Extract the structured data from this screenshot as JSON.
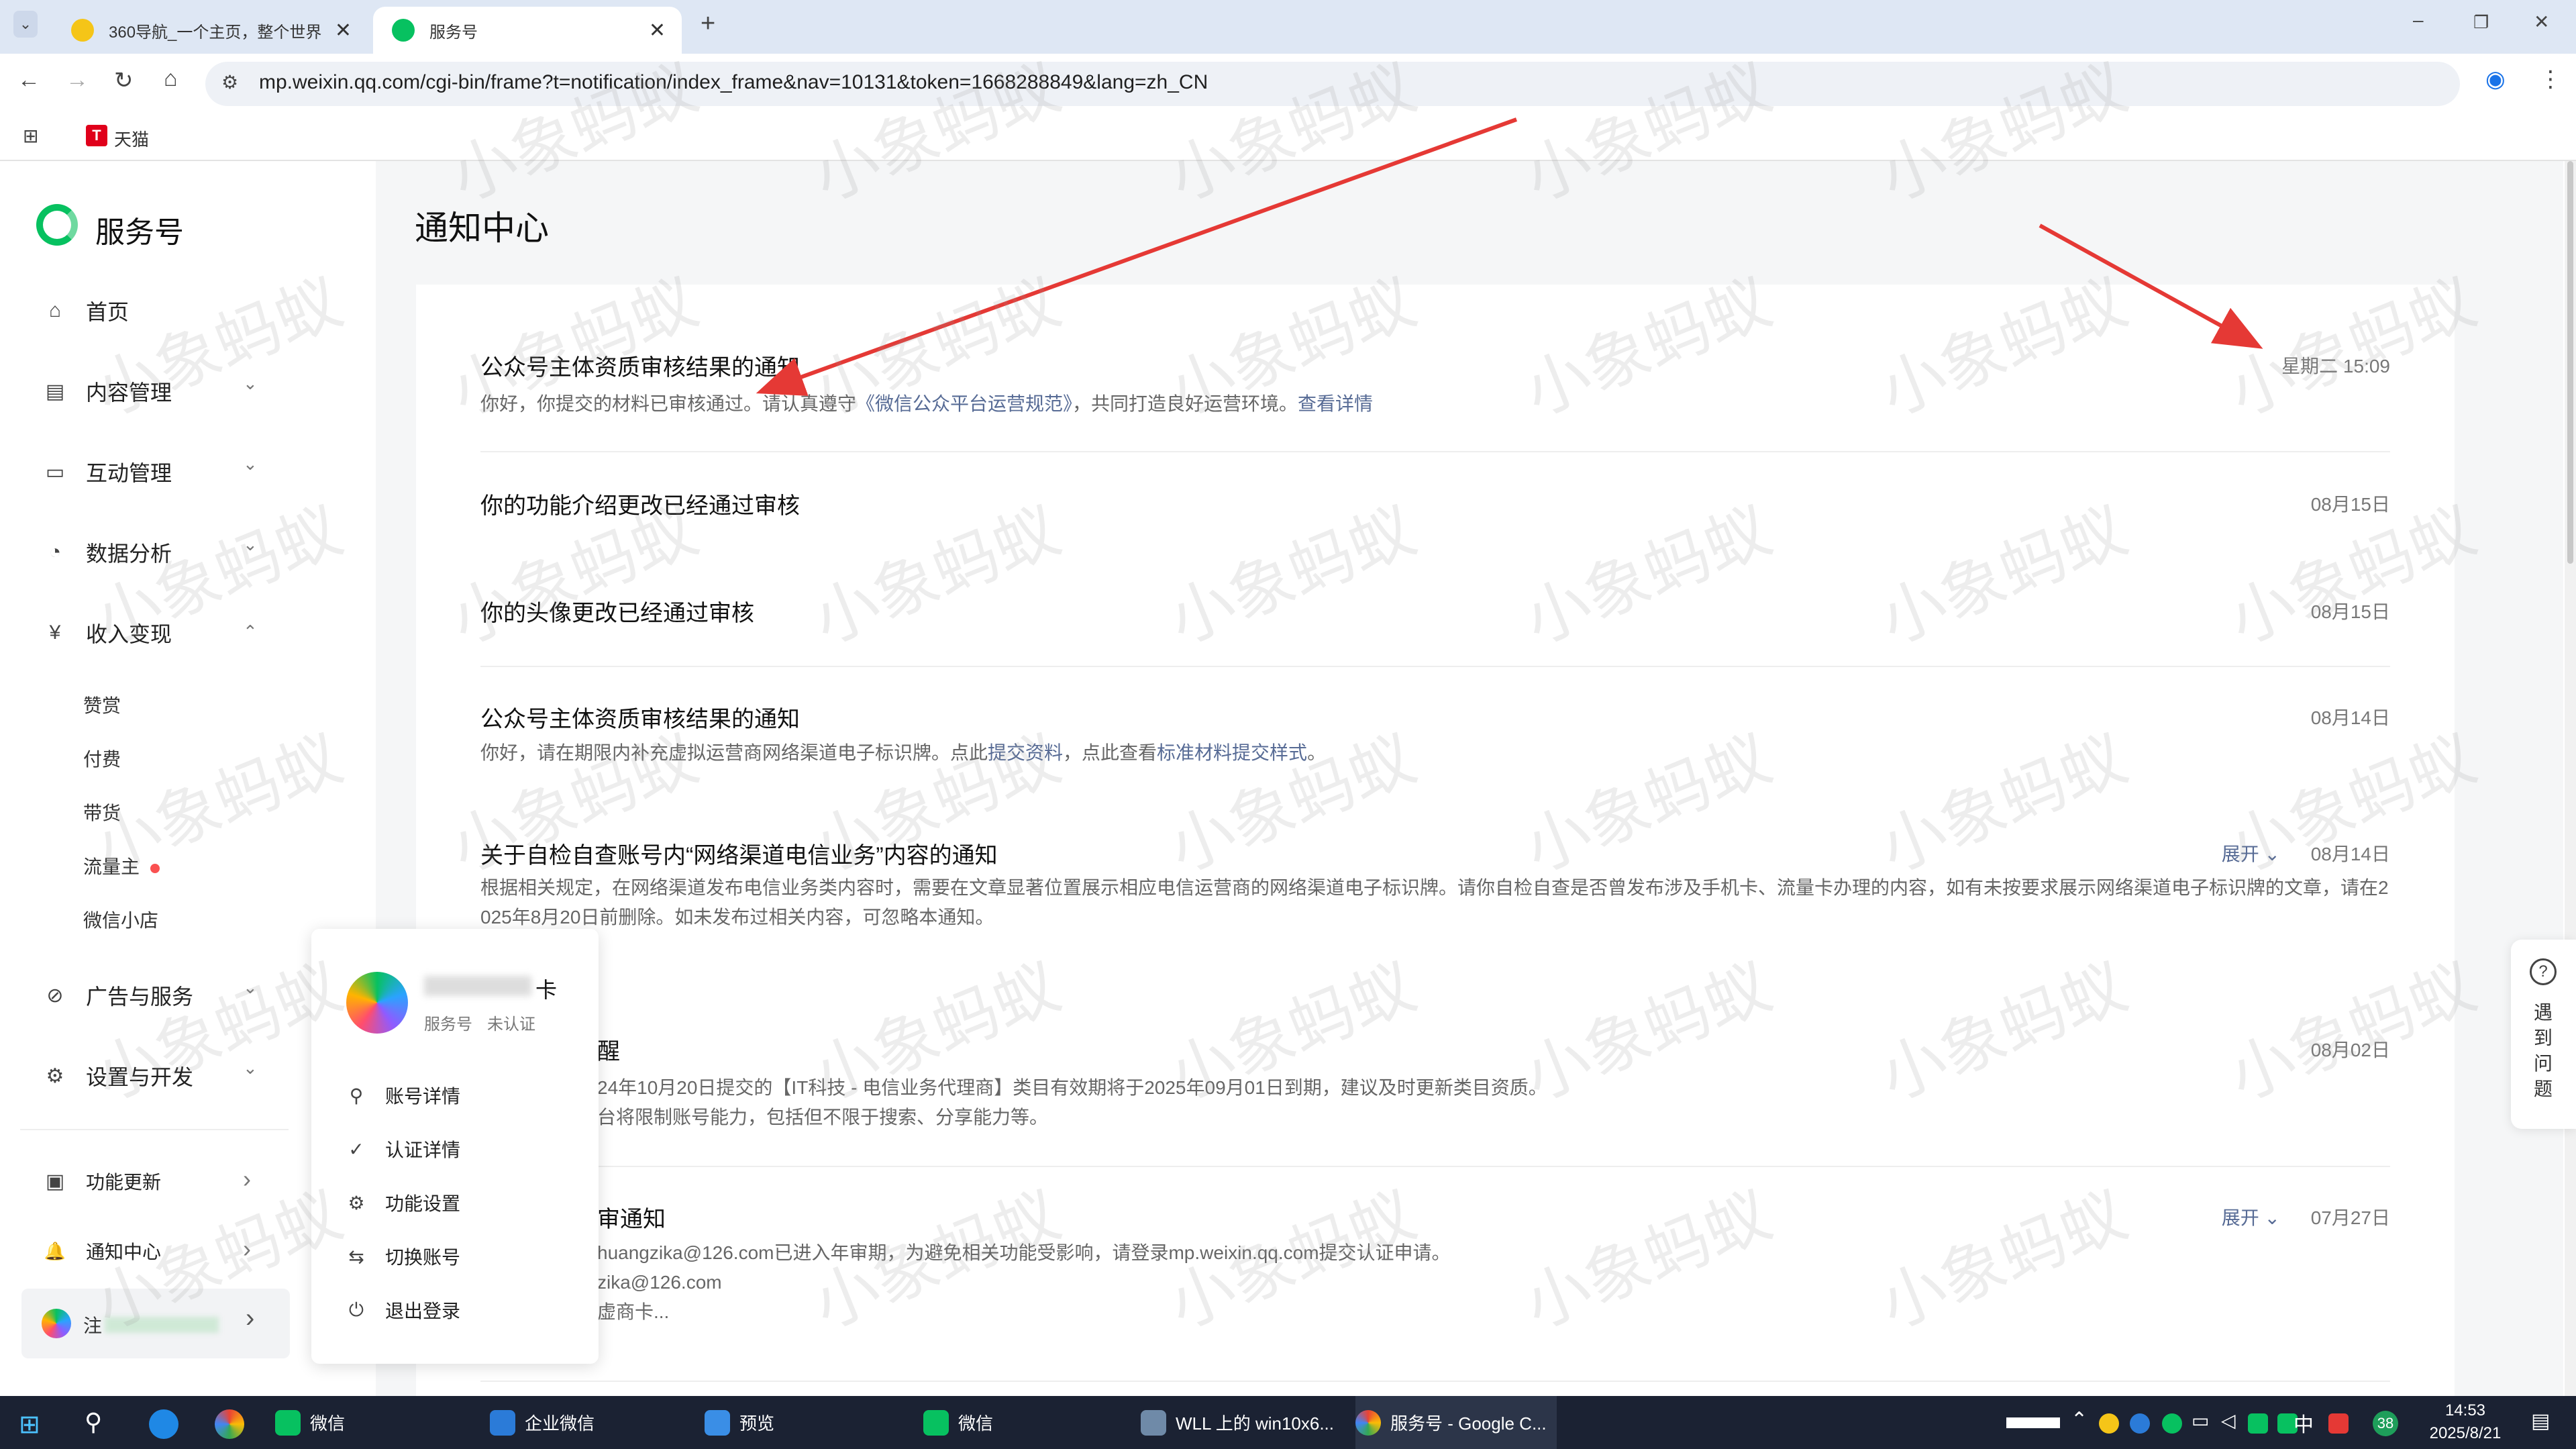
{
  "browser": {
    "tabs": [
      {
        "title": "360导航_一个主页，整个世界",
        "active": false
      },
      {
        "title": "服务号",
        "active": true
      }
    ],
    "new_tab": "+",
    "url": "mp.weixin.qq.com/cgi-bin/frame?t=notification/index_frame&nav=10131&token=1668288849&lang=zh_CN",
    "bookmarks": [
      {
        "label": "天猫",
        "icon_text": "T"
      }
    ],
    "window_controls": {
      "minimize": "–",
      "restore": "❐",
      "close": "✕"
    }
  },
  "sidebar": {
    "brand": "服务号",
    "items": [
      {
        "label": "首页",
        "icon": "home-icon"
      },
      {
        "label": "内容管理",
        "icon": "document-icon",
        "chevron": "down"
      },
      {
        "label": "互动管理",
        "icon": "chat-icon",
        "chevron": "down"
      },
      {
        "label": "数据分析",
        "icon": "pie-chart-icon",
        "chevron": "down"
      },
      {
        "label": "收入变现",
        "icon": "yen-icon",
        "chevron": "up"
      }
    ],
    "sub_items": [
      "赞赏",
      "付费",
      "带货",
      "流量主",
      "微信小店"
    ],
    "items2": [
      {
        "label": "广告与服务",
        "icon": "compass-icon",
        "chevron": "down"
      },
      {
        "label": "设置与开发",
        "icon": "gear-icon",
        "chevron": "down"
      }
    ],
    "bottom": [
      {
        "label": "功能更新",
        "icon": "update-icon"
      },
      {
        "label": "通知中心",
        "icon": "bell-icon"
      }
    ],
    "account_name": "注",
    "icons": {
      "home": "⌂",
      "doc": "▤",
      "chat": "▭",
      "pie": "◔",
      "yen": "¥",
      "compass": "⊘",
      "gear": "⚙",
      "update": "▣",
      "bell": "🔔",
      "chevron_down": "⌄",
      "chevron_up": "⌃",
      "chevron_right": "›"
    }
  },
  "main": {
    "title": "通知中心",
    "notifications": [
      {
        "title": "公众号主体资质审核结果的通知",
        "desc": "你好，你提交的材料已审核通过。请认真遵守",
        "link1": "《微信公众平台运营规范》",
        "desc2": "，共同打造良好运营环境。",
        "link2": "查看详情",
        "date": "星期二 15:09"
      },
      {
        "title": "你的功能介绍更改已经通过审核",
        "date": "08月15日"
      },
      {
        "title": "你的头像更改已经通过审核",
        "date": "08月15日"
      },
      {
        "title": "公众号主体资质审核结果的通知",
        "desc": "你好，请在期限内补充虚拟运营商网络渠道电子标识牌。点此",
        "link1": "提交资料",
        "desc2": "，点此查看",
        "link2": "标准材料提交样式",
        "desc3": "。",
        "date": "08月14日"
      },
      {
        "title": "关于自检自查账号内“网络渠道电信业务”内容的通知",
        "expand": "展开",
        "desc_line1": "根据相关规定，在网络渠道发布电信业务类内容时，需要在文章显著位置展示相应电信运营商的网络渠道电子标识牌。请你自检自查是否曾发布涉及手机卡、流量卡办理的内容，如有未按要求展示网络渠道电子标识牌的文章，请在2",
        "desc_line2": "025年8月20日前删除。如未发布过相关内容，可忽略本通知。",
        "date": "08月14日"
      },
      {
        "title": "醒",
        "desc_line1": "24年10月20日提交的【IT科技 - 电信业务代理商】类目有效期将于2025年09月01日到期，建议及时更新类目资质。",
        "desc_line2": "台将限制账号能力，包括但不限于搜索、分享能力等。",
        "date": "08月02日"
      },
      {
        "title": "审通知",
        "expand": "展开",
        "desc_line1": "huangzika@126.com已进入年审期，为避免相关功能受影响，请登录mp.weixin.qq.com提交认证申请。",
        "desc_line2": "zika@126.com",
        "desc_line3": "虚商卡...",
        "date": "07月27日"
      }
    ]
  },
  "popup": {
    "name_suffix": "卡",
    "type": "服务号",
    "status": "未认证",
    "menu": [
      {
        "label": "账号详情",
        "icon": "user-icon",
        "glyph": "⚲"
      },
      {
        "label": "认证详情",
        "icon": "check-circle-icon",
        "glyph": "✓"
      },
      {
        "label": "功能设置",
        "icon": "gear-icon",
        "glyph": "⚙"
      },
      {
        "label": "切换账号",
        "icon": "switch-icon",
        "glyph": "⇆"
      },
      {
        "label": "退出登录",
        "icon": "power-icon",
        "glyph": "⏻"
      }
    ]
  },
  "help": {
    "label": [
      "遇",
      "到",
      "问",
      "题"
    ],
    "icon_text": "?"
  },
  "taskbar": {
    "apps": [
      "微信",
      "企业微信",
      "预览",
      "微信",
      "WLL 上的 win10x6...",
      "服务号 - Google C..."
    ],
    "tray_ime": "中",
    "tray_badge": "38",
    "time": "14:53",
    "date": "2025/8/21"
  },
  "watermark": "小象蚂蚁",
  "colors": {
    "brand_green": "#07c160",
    "link": "#576b95",
    "arrow_red": "#e53935",
    "taskbar": "#1b2233",
    "tabbar": "#dee7f4"
  }
}
